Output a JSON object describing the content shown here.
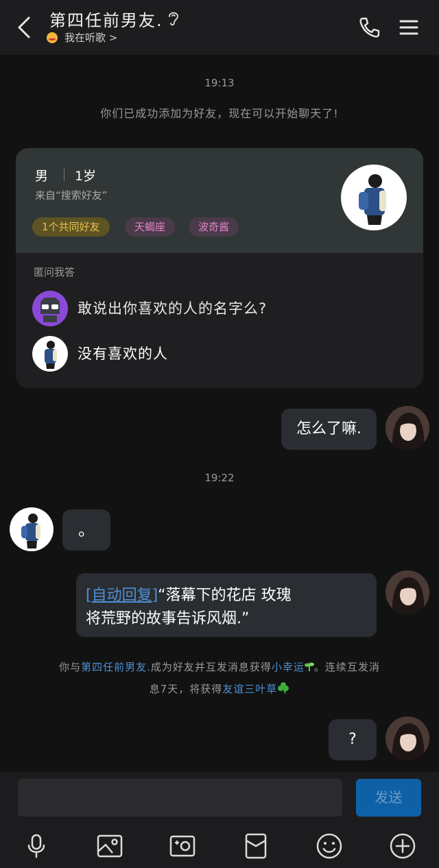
{
  "header": {
    "title": "第四任前男友.",
    "status_text": "我在听歌 >"
  },
  "messages": {
    "time1": "19:13",
    "system_added": "你们已成功添加为好友，现在可以开始聊天了!",
    "time2": "19:22",
    "me_msg1": "怎么了嘛.",
    "her_msg1": "。",
    "auto_reply_tag": "[自动回复]",
    "auto_reply_line1": "“落幕下的花店 玫瑰",
    "auto_reply_line2": "将荒野的故事告诉风烟.”",
    "streak_prefix": "你与",
    "streak_name": "第四任前男友.",
    "streak_mid": "成为好友并互发消息获得",
    "streak_reward1": "小幸运",
    "streak_mid2": "。连续互发消",
    "streak_line2_prefix": "息7天，将获得",
    "streak_reward2": "友谊三叶草",
    "me_msg2": "?"
  },
  "profile_card": {
    "gender": "男",
    "age": "1岁",
    "source": "来自“搜索好友”",
    "tags": [
      "1个共同好友",
      "天蝎座",
      "波奇酱"
    ],
    "qa_title": "匿问我答",
    "question": "敢说出你喜欢的人的名字么?",
    "answer": "没有喜欢的人"
  },
  "input": {
    "placeholder": "",
    "send_label": "发送"
  },
  "colors": {
    "link": "#4f8fd6",
    "tag_gold": "#e4c24d",
    "tag_pink": "#e184c7",
    "send": "#0e61a7"
  },
  "icons": [
    "back-icon",
    "ear-icon",
    "phone-icon",
    "menu-icon",
    "mic-icon",
    "image-icon",
    "camera-icon",
    "red-packet-icon",
    "emoji-icon",
    "plus-icon"
  ]
}
